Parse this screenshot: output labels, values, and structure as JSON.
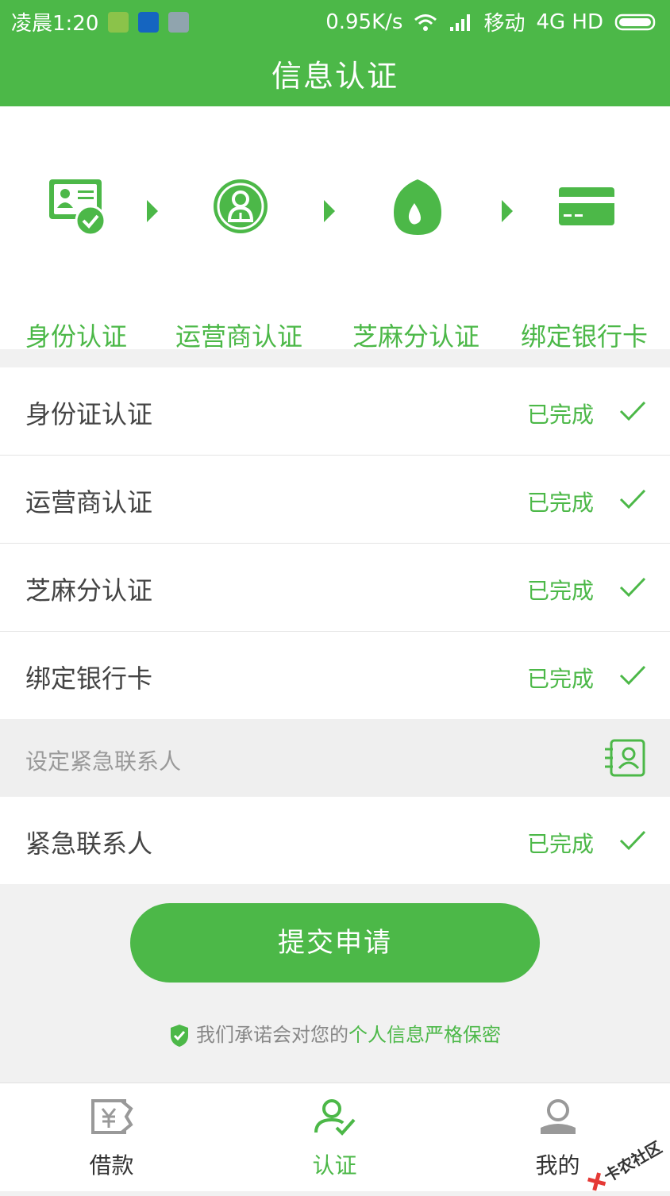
{
  "status_bar": {
    "time": "凌晨1:20",
    "speed": "0.95K/s",
    "carrier": "移动",
    "network": "4G HD"
  },
  "header": {
    "title": "信息认证"
  },
  "steps": [
    {
      "label": "身份认证",
      "icon": "id-card-check-icon"
    },
    {
      "label": "运营商认证",
      "icon": "operator-person-icon"
    },
    {
      "label": "芝麻分认证",
      "icon": "sesame-drop-icon"
    },
    {
      "label": "绑定银行卡",
      "icon": "bank-card-icon"
    }
  ],
  "items": [
    {
      "label": "身份证认证",
      "status": "已完成"
    },
    {
      "label": "运营商认证",
      "status": "已完成"
    },
    {
      "label": "芝麻分认证",
      "status": "已完成"
    },
    {
      "label": "绑定银行卡",
      "status": "已完成"
    }
  ],
  "emergency_section": {
    "title": "设定紧急联系人",
    "icon": "contact-card-icon"
  },
  "emergency_item": {
    "label": "紧急联系人",
    "status": "已完成"
  },
  "submit": {
    "label": "提交申请"
  },
  "promise": {
    "text_plain": "我们承诺会对您的",
    "text_highlight": "个人信息严格保密"
  },
  "tabs": [
    {
      "label": "借款",
      "icon": "loan-icon",
      "active": false
    },
    {
      "label": "认证",
      "icon": "verify-user-icon",
      "active": true
    },
    {
      "label": "我的",
      "icon": "profile-icon",
      "active": false
    }
  ],
  "watermark": {
    "text": "卡农社区"
  },
  "colors": {
    "accent": "#4cb848",
    "inactive": "#999999"
  }
}
